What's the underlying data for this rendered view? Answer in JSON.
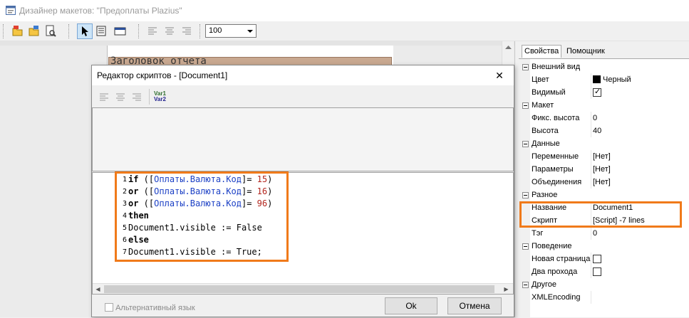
{
  "window": {
    "title": "Дизайнер макетов: \"Предоплаты Plazius\"",
    "icon": "designer-app-icon"
  },
  "toolbar": {
    "zoom_value": "100",
    "buttons": [
      "open-icon",
      "open-alt-icon",
      "preview-icon",
      "pointer-icon",
      "band-icon",
      "window-icon",
      "align-left-icon",
      "align-center-icon",
      "align-right-icon"
    ]
  },
  "workspace": {
    "band_title": "Заголовок отчета"
  },
  "script_editor": {
    "title": "Редактор скриптов - [Document1]",
    "close_symbol": "✕",
    "var1": "Var1",
    "var2": "Var2",
    "lines": [
      {
        "num": "1",
        "text": "if ([Оплаты.Валюта.Код]= 15)"
      },
      {
        "num": "2",
        "text": "or ([Оплаты.Валюта.Код]= 16)"
      },
      {
        "num": "3",
        "text": "or ([Оплаты.Валюта.Код]= 96)"
      },
      {
        "num": "4",
        "text": "then"
      },
      {
        "num": "5",
        "text": "Document1.visible := False"
      },
      {
        "num": "6",
        "text": "else"
      },
      {
        "num": "7",
        "text": "Document1.visible := True;"
      }
    ],
    "alt_language_label": "Альтернативный язык",
    "ok_label": "Ok",
    "cancel_label": "Отмена"
  },
  "properties": {
    "tabs": [
      "Свойства",
      "Помощник"
    ],
    "rows": [
      {
        "type": "category",
        "name": "Внешний вид"
      },
      {
        "type": "prop",
        "name": "Цвет",
        "value": "Черный",
        "swatch": "#000000"
      },
      {
        "type": "prop",
        "name": "Видимый",
        "checkbox": true
      },
      {
        "type": "category",
        "name": "Макет"
      },
      {
        "type": "prop",
        "name": "Фикс. высота",
        "value": "0"
      },
      {
        "type": "prop",
        "name": "Высота",
        "value": "40"
      },
      {
        "type": "category",
        "name": "Данные"
      },
      {
        "type": "prop",
        "name": "Переменные",
        "value": "[Нет]"
      },
      {
        "type": "prop",
        "name": "Параметры",
        "value": "[Нет]"
      },
      {
        "type": "prop",
        "name": "Объединения",
        "value": "[Нет]"
      },
      {
        "type": "category",
        "name": "Разное"
      },
      {
        "type": "prop",
        "name": "Название",
        "value": "Document1"
      },
      {
        "type": "prop",
        "name": "Скрипт",
        "value": "[Script] -7 lines"
      },
      {
        "type": "prop",
        "name": "Тэг",
        "value": "0"
      },
      {
        "type": "category",
        "name": "Поведение"
      },
      {
        "type": "prop",
        "name": "Новая страница",
        "checkbox": false
      },
      {
        "type": "prop",
        "name": "Два прохода",
        "checkbox": false
      },
      {
        "type": "category",
        "name": "Другое"
      },
      {
        "type": "prop",
        "name": "XMLEncoding",
        "value": ""
      }
    ]
  },
  "colors": {
    "highlight": "#f07a1a",
    "field_blue": "#1a3fc5",
    "number_red": "#b3261e"
  }
}
